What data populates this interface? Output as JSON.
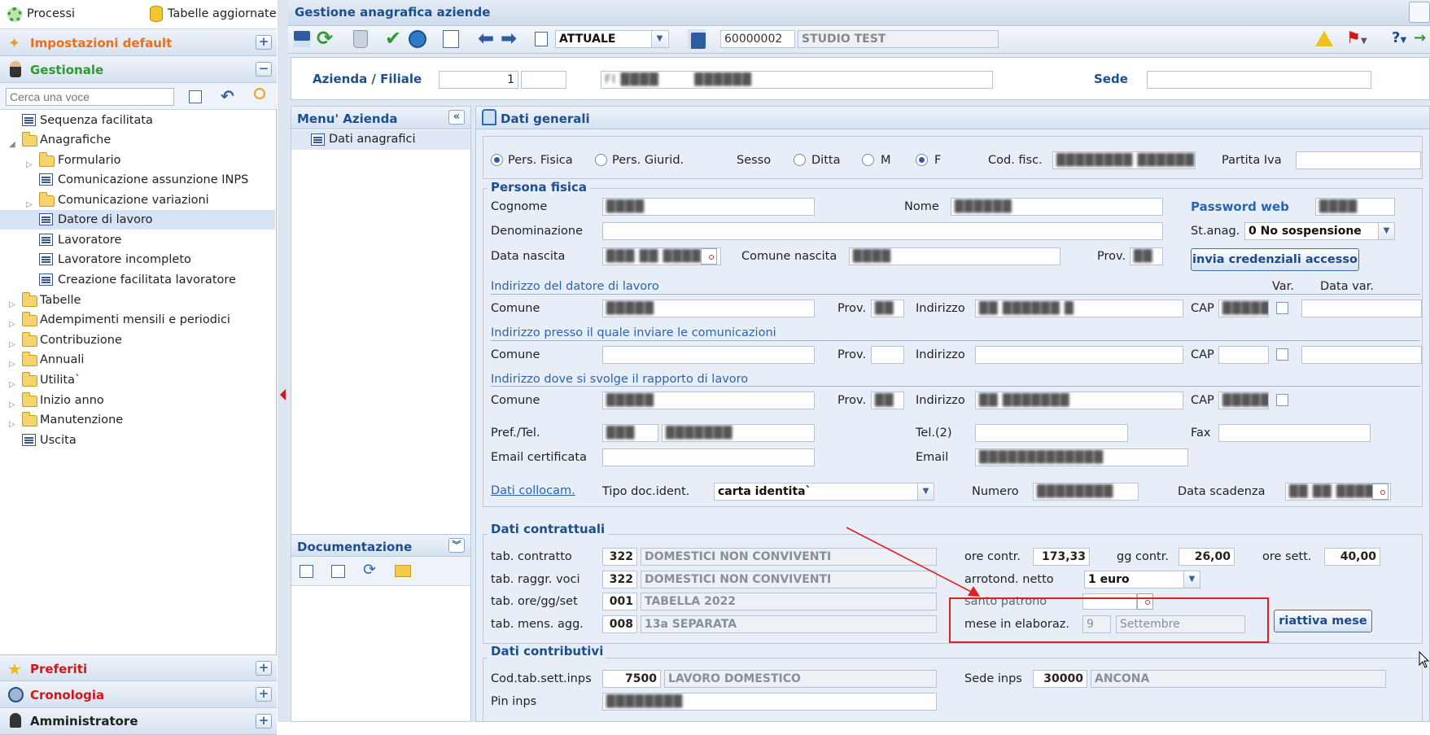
{
  "sidebar": {
    "processi": "Processi",
    "tabelle_aggiornate": "Tabelle aggiornate",
    "impostazioni": "Impostazioni default",
    "gestionale": "Gestionale",
    "search_placeholder": "Cerca una voce",
    "tree": [
      {
        "label": "Sequenza facilitata"
      },
      {
        "label": "Anagrafiche"
      },
      {
        "label": "Formulario"
      },
      {
        "label": "Comunicazione assunzione INPS"
      },
      {
        "label": "Comunicazione variazioni"
      },
      {
        "label": "Datore di lavoro"
      },
      {
        "label": "Lavoratore"
      },
      {
        "label": "Lavoratore incompleto"
      },
      {
        "label": "Creazione facilitata lavoratore"
      },
      {
        "label": "Tabelle"
      },
      {
        "label": "Adempimenti mensili e periodici"
      },
      {
        "label": "Contribuzione"
      },
      {
        "label": "Annuali"
      },
      {
        "label": "Utilita`"
      },
      {
        "label": "Inizio anno"
      },
      {
        "label": "Manutenzione"
      },
      {
        "label": "Uscita"
      }
    ],
    "preferiti": "Preferiti",
    "cronologia": "Cronologia",
    "amministratore": "Amministratore"
  },
  "window": {
    "title": "Gestione anagrafica aziende"
  },
  "toolbar": {
    "period_select": "ATTUALE",
    "company_code": "60000002",
    "company_name": "STUDIO TEST"
  },
  "header": {
    "azienda_label": "Azienda / Filiale",
    "azienda_value": "1",
    "sede_label": "Sede"
  },
  "menu_azienda": {
    "title": "Menu' Azienda",
    "items": [
      "Dati anagrafici"
    ],
    "documentazione": "Documentazione"
  },
  "form": {
    "title": "Dati generali",
    "pers_fisica": "Pers. Fisica",
    "pers_giurid": "Pers. Giurid.",
    "sesso": "Sesso",
    "ditta": "Ditta",
    "m": "M",
    "f": "F",
    "cod_fisc": "Cod. fisc.",
    "partita_iva": "Partita Iva",
    "persona_fisica_title": "Persona fisica",
    "cognome": "Cognome",
    "nome": "Nome",
    "password_web": "Password web",
    "denominazione": "Denominazione",
    "st_anag": "St.anag.",
    "st_anag_value": "0 No sospensione",
    "data_nascita": "Data nascita",
    "comune_nascita": "Comune nascita",
    "prov": "Prov.",
    "invia_credenziali": "invia credenziali accesso",
    "ind_datore": "Indirizzo del datore di lavoro",
    "var": "Var.",
    "data_var": "Data var.",
    "comune": "Comune",
    "indirizzo": "Indirizzo",
    "cap": "CAP",
    "ind_comunicazioni": "Indirizzo presso il quale inviare le comunicazioni",
    "ind_rapporto": "Indirizzo dove si svolge il rapporto di lavoro",
    "pref_tel": "Pref./Tel.",
    "tel2": "Tel.(2)",
    "fax": "Fax",
    "email_cert": "Email certificata",
    "email": "Email",
    "dati_collocam": "Dati collocam.",
    "tipo_doc": "Tipo doc.ident.",
    "tipo_doc_value": "carta identita`",
    "numero": "Numero",
    "data_scadenza": "Data scadenza"
  },
  "contrattuali": {
    "title": "Dati contrattuali",
    "rows": [
      {
        "label": "tab. contratto",
        "code": "322",
        "desc": "DOMESTICI NON CONVIVENTI"
      },
      {
        "label": "tab. raggr. voci",
        "code": "322",
        "desc": "DOMESTICI NON CONVIVENTI"
      },
      {
        "label": "tab. ore/gg/set",
        "code": "001",
        "desc": "TABELLA 2022"
      },
      {
        "label": "tab. mens. agg.",
        "code": "008",
        "desc": "13a SEPARATA"
      }
    ],
    "ore_contr_label": "ore contr.",
    "ore_contr": "173,33",
    "gg_contr_label": "gg contr.",
    "gg_contr": "26,00",
    "ore_sett_label": "ore sett.",
    "ore_sett": "40,00",
    "arrotond_label": "arrotond. netto",
    "arrotond_value": "1 euro",
    "santo_patrono": "santo patrono",
    "mese_elab_label": "mese in elaboraz.",
    "mese_num": "9",
    "mese_nome": "Settembre",
    "riattiva": "riattiva mese"
  },
  "contributivi": {
    "title": "Dati contributivi",
    "cod_tab_label": "Cod.tab.sett.inps",
    "cod_tab": "7500",
    "cod_tab_desc": "LAVORO DOMESTICO",
    "sede_inps_label": "Sede inps",
    "sede_inps": "30000",
    "sede_inps_desc": "ANCONA",
    "pin_inps": "Pin inps"
  },
  "colors": {
    "accent": "#1d4f8f",
    "orange": "#e8711a",
    "green": "#2f9a2f",
    "red": "#d01818",
    "annotation": "#e02020"
  }
}
